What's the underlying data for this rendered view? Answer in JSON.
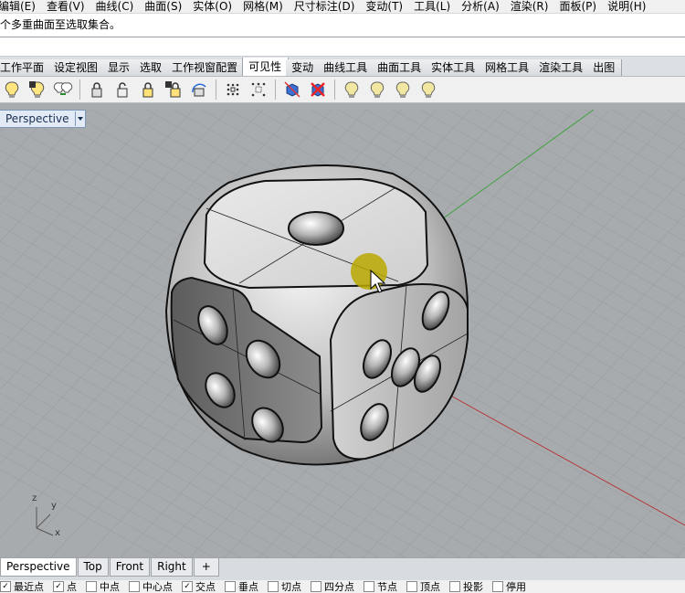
{
  "menu": [
    "编辑(E)",
    "查看(V)",
    "曲线(C)",
    "曲面(S)",
    "实体(O)",
    "网格(M)",
    "尺寸标注(D)",
    "变动(T)",
    "工具(L)",
    "分析(A)",
    "渲染(R)",
    "面板(P)",
    "说明(H)"
  ],
  "command": {
    "history": "个多重曲面至选取集合。",
    "input": ""
  },
  "tabs": [
    {
      "label": "工作平面",
      "active": false
    },
    {
      "label": "设定视图",
      "active": false
    },
    {
      "label": "显示",
      "active": false
    },
    {
      "label": "选取",
      "active": false
    },
    {
      "label": "工作视窗配置",
      "active": false
    },
    {
      "label": "可见性",
      "active": true
    },
    {
      "label": "变动",
      "active": false
    },
    {
      "label": "曲线工具",
      "active": false
    },
    {
      "label": "曲面工具",
      "active": false
    },
    {
      "label": "实体工具",
      "active": false
    },
    {
      "label": "网格工具",
      "active": false
    },
    {
      "label": "渲染工具",
      "active": false
    },
    {
      "label": "出图",
      "active": false
    }
  ],
  "toolbar_icons": [
    "bulb-icon",
    "bulb-swap-icon",
    "bulb-multi-icon",
    "lock-icon",
    "unlock-icon",
    "lock-selected-icon",
    "lock-swap-icon",
    "lock-rotate-icon",
    "points-grid-icon",
    "points-hide-icon",
    "cube-show-icon",
    "cube-hide-icon",
    "bulb-plain-icon",
    "bulb-plain-icon",
    "bulb-plain-icon",
    "bulb-plain-icon"
  ],
  "viewport": {
    "title": "Perspective",
    "axis": {
      "z": "z",
      "y": "y",
      "x": "x"
    }
  },
  "view_tabs": [
    {
      "label": "Perspective",
      "active": true
    },
    {
      "label": "Top",
      "active": false
    },
    {
      "label": "Front",
      "active": false
    },
    {
      "label": "Right",
      "active": false
    },
    {
      "label": "+",
      "active": false
    }
  ],
  "osnap": [
    {
      "label": "最近点",
      "checked": true
    },
    {
      "label": "点",
      "checked": true
    },
    {
      "label": "中点",
      "checked": false
    },
    {
      "label": "中心点",
      "checked": false
    },
    {
      "label": "交点",
      "checked": true
    },
    {
      "label": "垂点",
      "checked": false
    },
    {
      "label": "切点",
      "checked": false
    },
    {
      "label": "四分点",
      "checked": false
    },
    {
      "label": "节点",
      "checked": false
    },
    {
      "label": "顶点",
      "checked": false
    },
    {
      "label": "投影",
      "checked": false
    },
    {
      "label": "停用",
      "checked": false
    }
  ],
  "colors": {
    "viewport_bg": "#a8abae",
    "grid_line": "#9a9ea2",
    "x_axis": "#b23a3a",
    "y_axis": "#3fa13f",
    "cursor_highlight": "#b8a800"
  }
}
